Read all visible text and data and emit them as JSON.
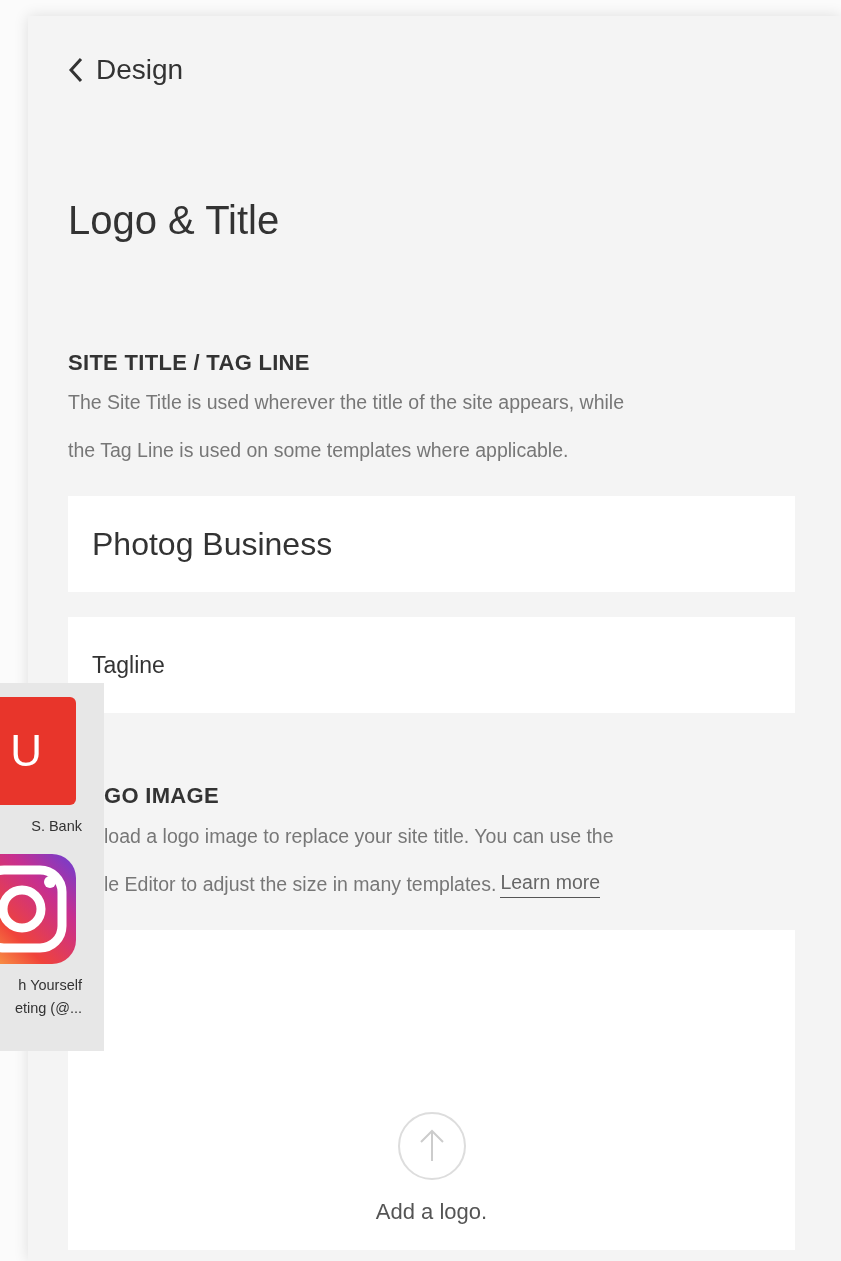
{
  "back_link": {
    "label": "Design"
  },
  "page_title": "Logo & Title",
  "sections": [
    {
      "heading": "SITE TITLE / TAG LINE",
      "description_lines": [
        {
          "text": "The Site Title is used wherever the title of the site appears, while"
        },
        {
          "text": "the Tag Line is used on some templates where applicable."
        }
      ],
      "fields": [
        {
          "kind": "large",
          "value": "Photog Business"
        },
        {
          "kind": "small",
          "value": "Tagline"
        }
      ]
    },
    {
      "heading": "GO IMAGE",
      "description_lines": [
        {
          "text": "load a logo image to replace your site title. You can use the"
        },
        {
          "text": "le Editor to adjust the size in many templates.",
          "link": "Learn more"
        }
      ],
      "upload": {
        "label": "Add a logo."
      }
    }
  ],
  "bookmarks": [
    {
      "kind": "letter",
      "letter": "U",
      "color": "#e8352b",
      "label_lines": [
        "S. Bank"
      ]
    },
    {
      "kind": "instagram",
      "label_lines": [
        "h Yourself",
        "eting (@..."
      ]
    }
  ]
}
